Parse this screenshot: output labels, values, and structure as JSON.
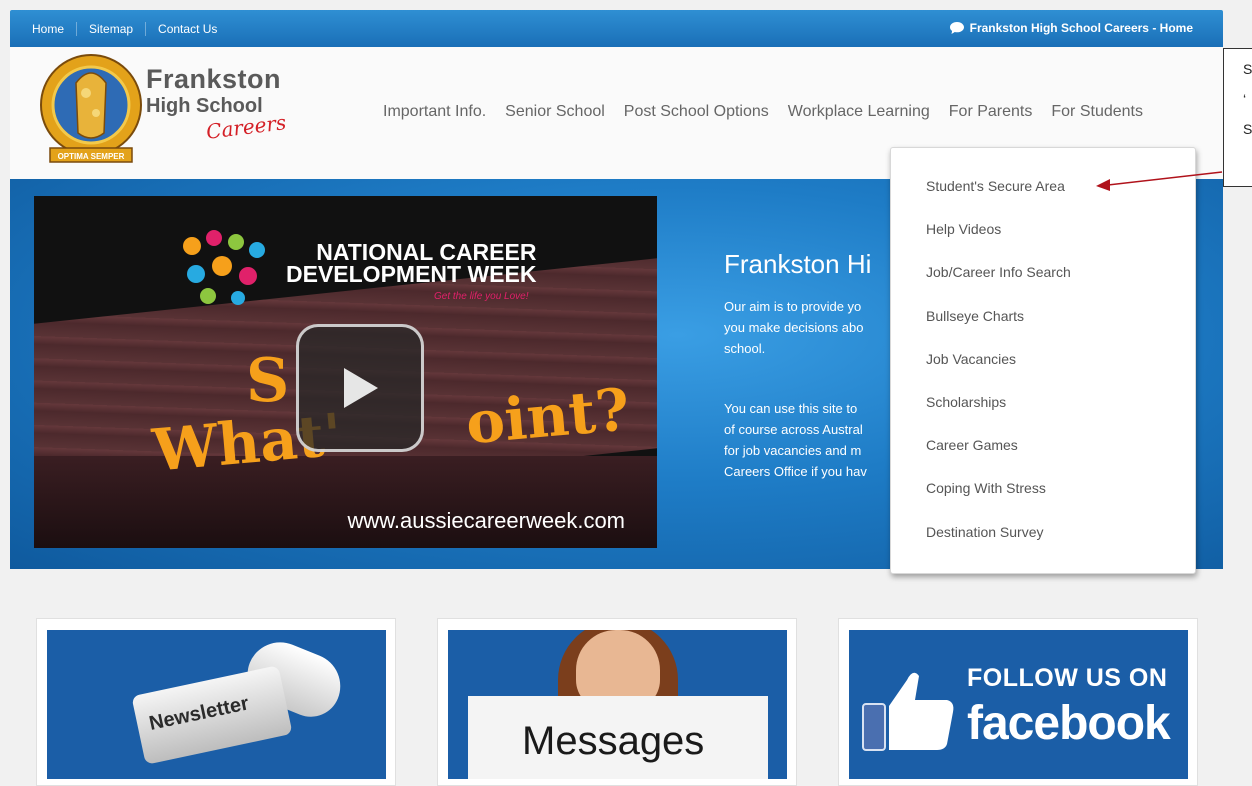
{
  "top_bar": {
    "links": [
      "Home",
      "Sitemap",
      "Contact Us"
    ],
    "right_link": "Frankston High School Careers - Home"
  },
  "logo": {
    "line1": "Frankston",
    "line2": "High School",
    "line3": "Careers",
    "badge_text": "OPTIMA SEMPER"
  },
  "main_nav": [
    "Important Info.",
    "Senior School",
    "Post School Options",
    "Workplace Learning",
    "For Parents",
    "For Students"
  ],
  "hero": {
    "video": {
      "heading_line1": "NATIONAL CAREER",
      "heading_line2": "DEVELOPMENT WEEK",
      "tagline": "Get the life you Love!",
      "overlay_line1": "S",
      "overlay_line2": "What'",
      "overlay_line3": "oint?",
      "url": "www.aussiecareerweek.com"
    },
    "title": "Frankston Hi",
    "para1": [
      "Our aim is to provide yo",
      "you make decisions abo",
      "school."
    ],
    "para2": [
      "You can use this site to",
      "of course across Austral",
      "for job vacancies and m",
      "Careers Office if you hav"
    ]
  },
  "dropdown": {
    "items": [
      "Student's Secure Area",
      "Help Videos",
      "Job/Career Info Search",
      "Bullseye Charts",
      "Job Vacancies",
      "Scholarships",
      "Career Games",
      "Coping With Stress",
      "Destination Survey"
    ]
  },
  "callout": {
    "chars": [
      "S",
      "‘",
      "S"
    ]
  },
  "tiles": {
    "newsletter": "Newsletter",
    "messages": "Messages",
    "facebook_line1": "FOLLOW US ON",
    "facebook_line2": "facebook"
  },
  "colors": {
    "top_bar": "#1f78c1",
    "hero_blue": "#1e7cc6",
    "tile_blue": "#1b5ea7",
    "arrow_red": "#b0121b",
    "logo_red": "#d42027"
  }
}
